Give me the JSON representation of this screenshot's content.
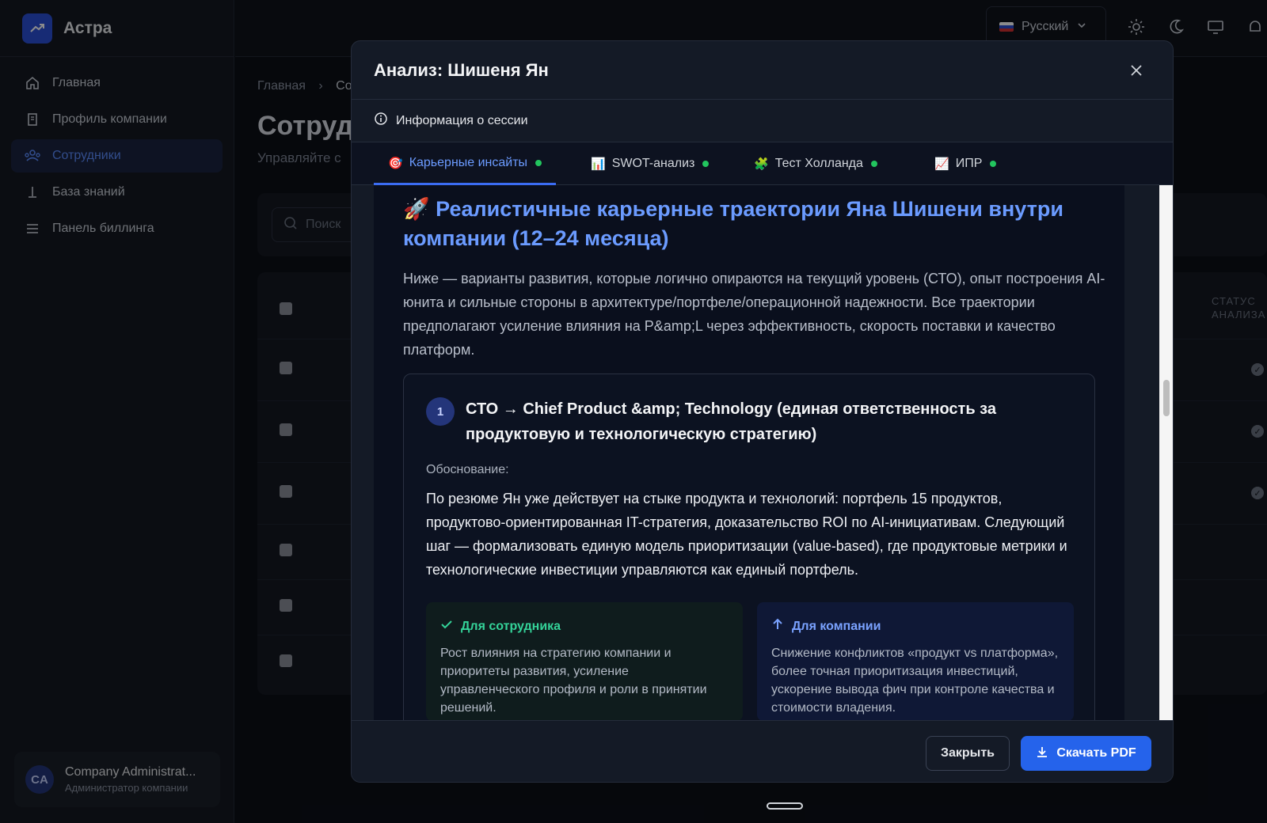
{
  "app": {
    "name": "Астра"
  },
  "sidebar": {
    "items": [
      {
        "label": "Главная",
        "icon": "home-icon"
      },
      {
        "label": "Профиль компании",
        "icon": "building-icon"
      },
      {
        "label": "Сотрудники",
        "icon": "users-icon",
        "active": true
      },
      {
        "label": "База знаний",
        "icon": "knowledge-icon"
      },
      {
        "label": "Панель биллинга",
        "icon": "billing-icon"
      }
    ],
    "user": {
      "initials": "CA",
      "name": "Company Administrat...",
      "role": "Администратор компании"
    }
  },
  "topbar": {
    "language": "Русский"
  },
  "page": {
    "breadcrumb": [
      "Главная",
      "Со"
    ],
    "title": "Сотруд",
    "subtitle": "Управляйте с",
    "search_placeholder": "Поиск",
    "table_status_header": "СТАТУС АНАЛИЗА"
  },
  "modal": {
    "title": "Анализ: Шишеня Ян",
    "session_info": "Информация о сессии",
    "tabs": [
      {
        "emoji": "🎯",
        "label": "Карьерные инсайты",
        "active": true
      },
      {
        "emoji": "📊",
        "label": "SWOT-анализ"
      },
      {
        "emoji": "🧩",
        "label": "Тест Холланда"
      },
      {
        "emoji": "📈",
        "label": "ИПР"
      }
    ],
    "content": {
      "heading": "🚀 Реалистичные карьерные траектории Яна Шишени внутри компании (12–24 месяца)",
      "intro": "Ниже — варианты развития, которые логично опираются на текущий уровень (СТО), опыт построения AI-юнита и сильные стороны в архитектуре/портфеле/операционной надежности. Все траектории предполагают усиление влияния на P&amp;L через эффективность, скорость поставки и качество платформ.",
      "card": {
        "number": "1",
        "title": "СТО → Chief Product &amp; Technology (единая ответственность за продуктовую и технологическую стратегию)",
        "justification_label": "Обоснование:",
        "justification": "По резюме Ян уже действует на стыке продукта и технологий: портфель 15 продуктов, продуктово-ориентированная IT-стратегия, доказательство ROI по AI-инициативам. Следующий шаг — формализовать единую модель приоритизации (value-based), где продуктовые метрики и технологические инвестиции управляются как единый портфель.",
        "for_employee_title": "Для сотрудника",
        "for_employee_text": "Рост влияния на стратегию компании и приоритеты развития, усиление управленческого профиля и роли в принятии решений.",
        "for_company_title": "Для компании",
        "for_company_text": "Снижение конфликтов «продукт vs платформа», более точная приоритизация инвестиций, ускорение вывода фич при контроле качества и стоимости владения."
      }
    },
    "buttons": {
      "close": "Закрыть",
      "download": "Скачать PDF"
    }
  },
  "colors": {
    "accent": "#2563eb",
    "link": "#6b9bff",
    "success": "#22c55e"
  }
}
